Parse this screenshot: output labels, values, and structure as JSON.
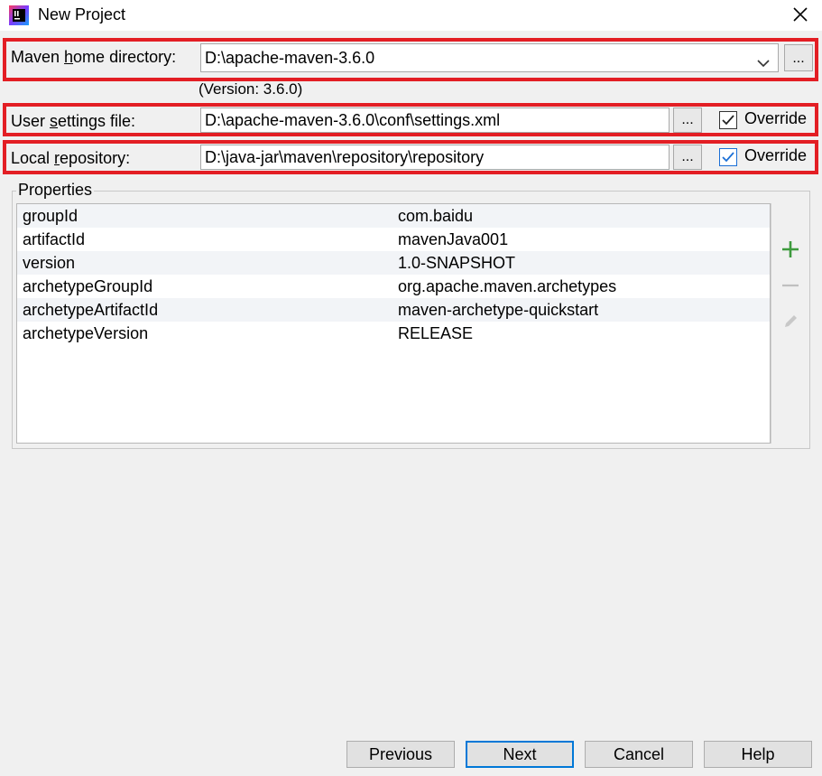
{
  "window": {
    "title": "New Project",
    "app_icon": "intellij-idea-icon",
    "close_icon": "close-icon"
  },
  "maven": {
    "home_label_pre": "Maven ",
    "home_label_u": "h",
    "home_label_post": "ome directory:",
    "home_value": "D:\\apache-maven-3.6.0",
    "version_text": "(Version: 3.6.0)",
    "settings_label_pre": "User ",
    "settings_label_u": "s",
    "settings_label_post": "ettings file:",
    "settings_value": "D:\\apache-maven-3.6.0\\conf\\settings.xml",
    "settings_override_label": "Override",
    "settings_override_checked": true,
    "repo_label_pre": "Local ",
    "repo_label_u": "r",
    "repo_label_post": "epository:",
    "repo_value": "D:\\java-jar\\maven\\repository\\repository",
    "repo_override_label": "Override",
    "repo_override_checked": true,
    "browse_label": "..."
  },
  "properties": {
    "title": "Properties",
    "rows": [
      {
        "key": "groupId",
        "value": "com.baidu"
      },
      {
        "key": "artifactId",
        "value": "mavenJava001"
      },
      {
        "key": "version",
        "value": "1.0-SNAPSHOT"
      },
      {
        "key": "archetypeGroupId",
        "value": "org.apache.maven.archetypes"
      },
      {
        "key": "archetypeArtifactId",
        "value": "maven-archetype-quickstart"
      },
      {
        "key": "archetypeVersion",
        "value": "RELEASE"
      }
    ],
    "tools": [
      "add-icon",
      "remove-icon",
      "edit-icon"
    ]
  },
  "buttons": {
    "previous": "Previous",
    "next": "Next",
    "cancel": "Cancel",
    "help": "Help"
  },
  "colors": {
    "highlight": "#e31e24",
    "add_green": "#3d9a3d",
    "checkbox_blue": "#1a6fd6"
  }
}
